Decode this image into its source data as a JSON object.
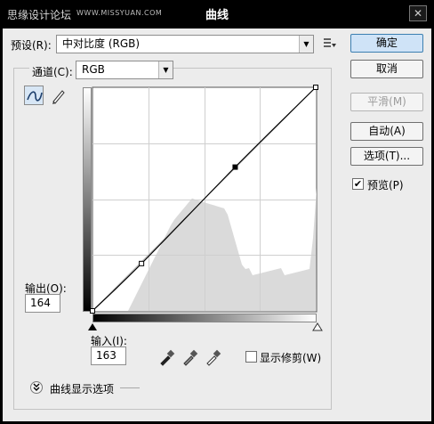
{
  "window": {
    "watermark": "思缘设计论坛",
    "watermark_sub": "WWW.MISSYUAN.COM",
    "title": "曲线",
    "close_label": "✕"
  },
  "preset": {
    "label": "预设(R):",
    "value": "中对比度 (RGB)"
  },
  "channel": {
    "label": "通道(C):",
    "value": "RGB"
  },
  "buttons": {
    "ok": "确定",
    "cancel": "取消",
    "smooth": "平滑(M)",
    "auto": "自动(A)",
    "options": "选项(T)...",
    "preview_label": "预览(P)",
    "preview_checked": true
  },
  "output": {
    "label": "输出(O):",
    "value": "164"
  },
  "input": {
    "label": "输入(I):",
    "value": "163"
  },
  "clipping": {
    "label": "显示修剪(W)",
    "checked": false
  },
  "curve_options": {
    "label": "曲线显示选项"
  },
  "curve": {
    "points": [
      [
        0,
        0
      ],
      [
        56,
        54
      ],
      [
        163,
        164
      ],
      [
        255,
        255
      ]
    ],
    "selected_point": [
      163,
      164
    ],
    "range": [
      0,
      255
    ]
  },
  "histogram": {
    "color": "#dadada"
  }
}
